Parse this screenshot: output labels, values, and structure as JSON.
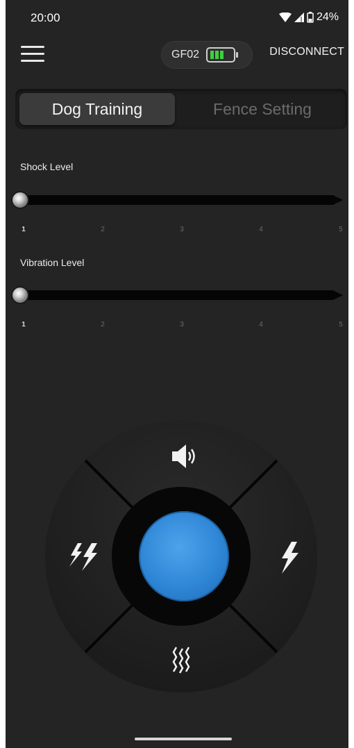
{
  "status_bar": {
    "time": "20:00",
    "battery_percent": "24%"
  },
  "top_bar": {
    "device_name": "GF02",
    "device_battery_level": 1.0,
    "disconnect_label": "DISCONNECT"
  },
  "tabs": [
    {
      "label": "Dog Training",
      "active": true
    },
    {
      "label": "Fence Setting",
      "active": false
    }
  ],
  "sliders": {
    "shock": {
      "label": "Shock Level",
      "value": 1,
      "ticks": [
        "1",
        "2",
        "3",
        "4",
        "5"
      ]
    },
    "vibration": {
      "label": "Vibration Level",
      "value": 1,
      "ticks": [
        "1",
        "2",
        "3",
        "4",
        "5"
      ]
    }
  },
  "controls": {
    "top": "speaker-icon",
    "left": "double-lightning-icon",
    "right": "lightning-icon",
    "bottom": "vibration-icon",
    "center_color": "#2e86d6"
  },
  "colors": {
    "background": "#242424",
    "battery_green": "#3ed13e",
    "accent_blue": "#2e86d6"
  }
}
